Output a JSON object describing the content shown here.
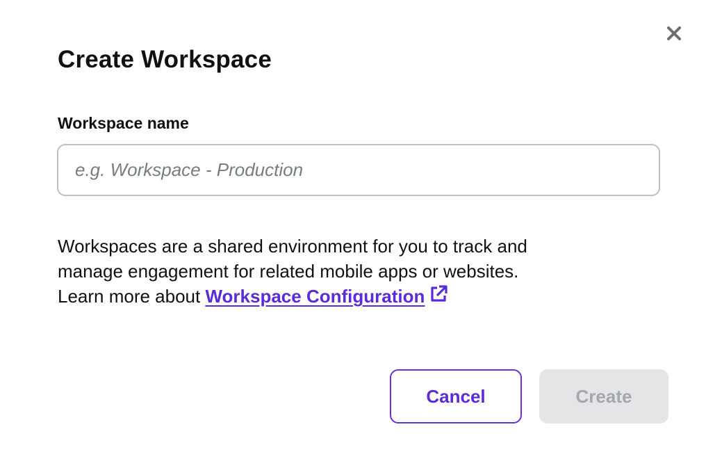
{
  "dialog": {
    "title": "Create Workspace",
    "close_icon": "close-icon"
  },
  "form": {
    "label": "Workspace name",
    "input_value": "",
    "input_placeholder": "e.g. Workspace - Production"
  },
  "description": {
    "line1": "Workspaces are a shared environment for you to track and",
    "line2": "manage engagement for related mobile apps or websites.",
    "line3_prefix": "Learn more about ",
    "link_text": "Workspace Configuration",
    "link_icon": "external-link-icon"
  },
  "actions": {
    "cancel_label": "Cancel",
    "create_label": "Create",
    "create_enabled": false
  },
  "colors": {
    "accent": "#5b2bd9",
    "disabled_bg": "#e4e5e6",
    "disabled_text": "#a4a8ab",
    "input_border": "#b9c0c4"
  }
}
